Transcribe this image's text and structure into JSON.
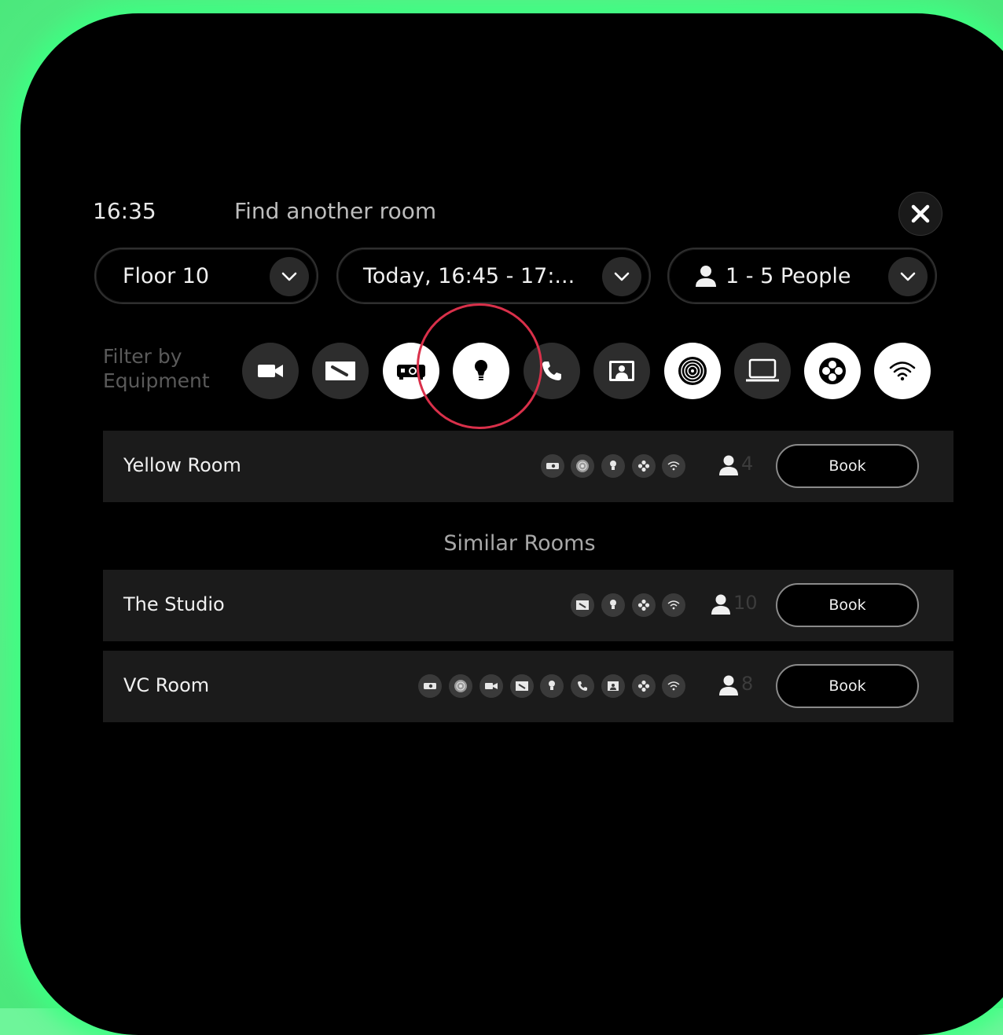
{
  "header": {
    "time": "16:35",
    "title": "Find another room"
  },
  "filters": {
    "floor": "Floor 10",
    "time_range": "Today, 16:45 - 17:...",
    "people": "1 - 5 People"
  },
  "equipment": {
    "label_line1": "Filter by",
    "label_line2": "Equipment",
    "items": [
      {
        "icon": "video-camera-icon",
        "selected": false
      },
      {
        "icon": "whiteboard-icon",
        "selected": false
      },
      {
        "icon": "projector-icon",
        "selected": true
      },
      {
        "icon": "lightbulb-icon",
        "selected": true
      },
      {
        "icon": "phone-icon",
        "selected": false
      },
      {
        "icon": "presenter-screen-icon",
        "selected": false
      },
      {
        "icon": "speaker-icon",
        "selected": true
      },
      {
        "icon": "laptop-icon",
        "selected": false
      },
      {
        "icon": "fan-icon",
        "selected": true
      },
      {
        "icon": "wifi-icon",
        "selected": true
      }
    ]
  },
  "highlight_color": "#d9304a",
  "primary_result": {
    "name": "Yellow Room",
    "icons": [
      "projector-icon",
      "speaker-icon",
      "lightbulb-icon",
      "fan-icon",
      "wifi-icon"
    ],
    "capacity": "4",
    "book_label": "Book"
  },
  "similar_heading": "Similar Rooms",
  "similar_rooms": [
    {
      "name": "The Studio",
      "icons": [
        "whiteboard-icon",
        "lightbulb-icon",
        "fan-icon",
        "wifi-icon"
      ],
      "capacity": "10",
      "book_label": "Book"
    },
    {
      "name": "VC Room",
      "icons": [
        "projector-icon",
        "speaker-icon",
        "video-camera-icon",
        "whiteboard-icon",
        "lightbulb-icon",
        "phone-icon",
        "presenter-screen-icon",
        "fan-icon",
        "wifi-icon"
      ],
      "capacity": "8",
      "book_label": "Book"
    }
  ]
}
